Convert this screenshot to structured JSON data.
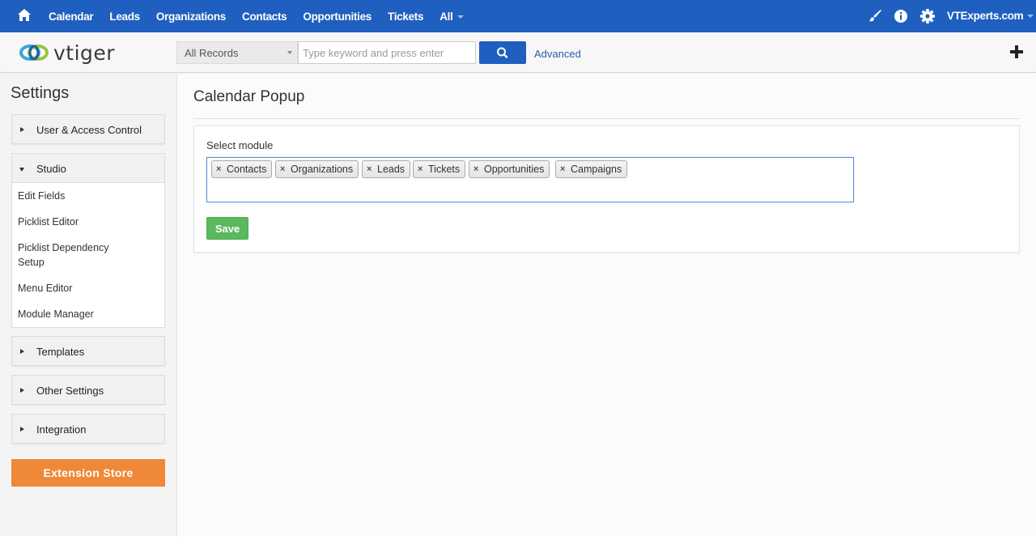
{
  "topnav": {
    "menu": [
      "Calendar",
      "Leads",
      "Organizations",
      "Contacts",
      "Opportunities",
      "Tickets",
      "All"
    ],
    "user": "VTExperts.com",
    "icons": [
      "home-icon",
      "paintbrush-icon",
      "info-icon",
      "gear-icon"
    ],
    "color": "#1f5fbf"
  },
  "subbar": {
    "logo_text": "vtiger",
    "records_select": "All Records",
    "search_placeholder": "Type keyword and press enter",
    "advanced_label": "Advanced"
  },
  "sidebar": {
    "title": "Settings",
    "sections": {
      "user_access": "User & Access Control",
      "studio": "Studio",
      "templates": "Templates",
      "other": "Other Settings",
      "integration": "Integration"
    },
    "studio_items": {
      "edit_fields": "Edit Fields",
      "picklist_editor": "Picklist Editor",
      "picklist_dep_1": "Picklist Dependency",
      "picklist_dep_2": "Setup",
      "menu_editor": "Menu Editor",
      "module_manager": "Module Manager"
    },
    "extension_store": "Extension Store"
  },
  "main": {
    "title": "Calendar Popup",
    "select_label": "Select module",
    "modules": [
      "Contacts",
      "Organizations",
      "Leads",
      "Tickets",
      "Opportunities",
      "Campaigns"
    ],
    "chip_remove_glyph": "×",
    "save_label": "Save"
  }
}
